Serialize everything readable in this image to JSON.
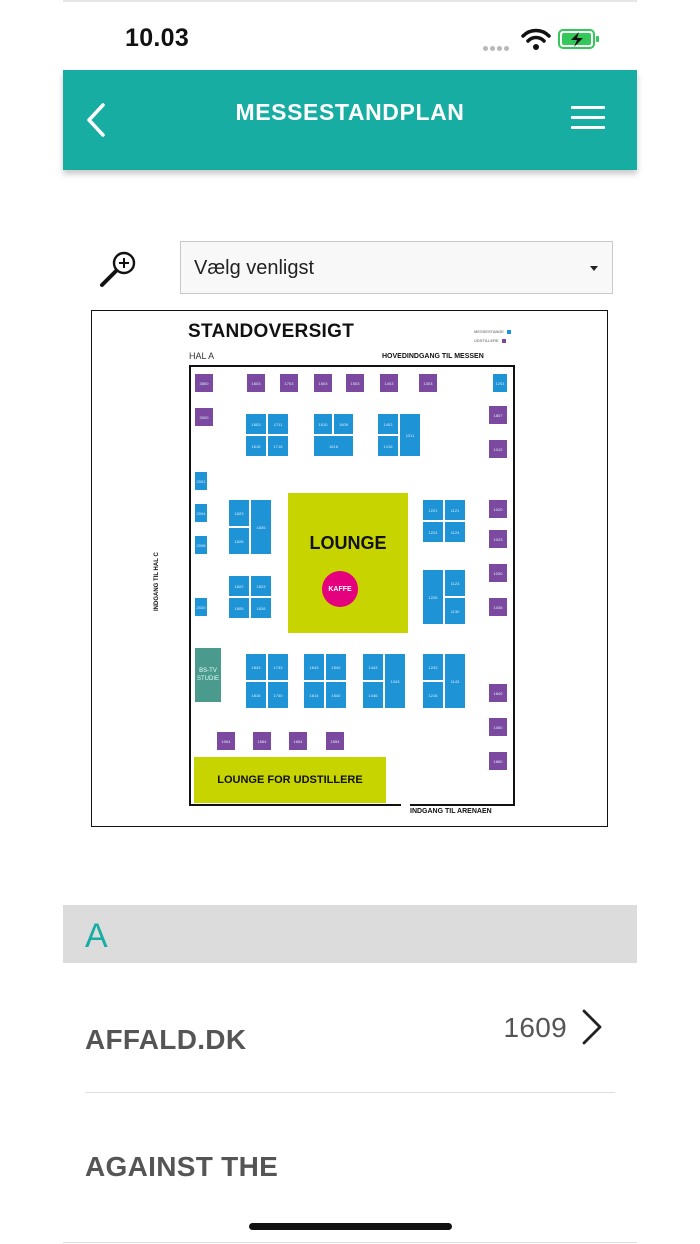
{
  "status_bar": {
    "time": "10.03"
  },
  "navbar": {
    "title": "MESSESTANDPLAN",
    "back_icon": "chevron-left-icon",
    "menu_icon": "hamburger-menu-icon"
  },
  "filter": {
    "zoom_icon": "zoom-in-icon",
    "select_value": "Vælg venligst"
  },
  "floorplan": {
    "title": "STANDOVERSIGT",
    "hall": "HAL A",
    "main_entrance": "HOVEDINDGANG TIL MESSEN",
    "arena_entrance": "INDGANG TIL ARENAEN",
    "hall_c_entrance": "INDGANG TIL HAL C",
    "legend": [
      "MESSESTANDE",
      "UDSTILLERE"
    ],
    "lounge": "LOUNGE",
    "kaffe": "KAFFE",
    "lounge_exhibitors": "LOUNGE FOR UDSTILLERE",
    "studio": "BS-TV STUDIE",
    "colors": {
      "booth_blue": "#1e93d6",
      "booth_purple": "#7b4aa0",
      "lounge_lime": "#c7d400",
      "kaffe_magenta": "#e5007d"
    }
  },
  "list": {
    "section_letter": "A",
    "items": [
      {
        "name": "AFFALD.DK",
        "stand": "1609"
      },
      {
        "name": "AGAINST THE",
        "stand": ""
      }
    ]
  },
  "theme": {
    "accent": "#17ada3"
  }
}
